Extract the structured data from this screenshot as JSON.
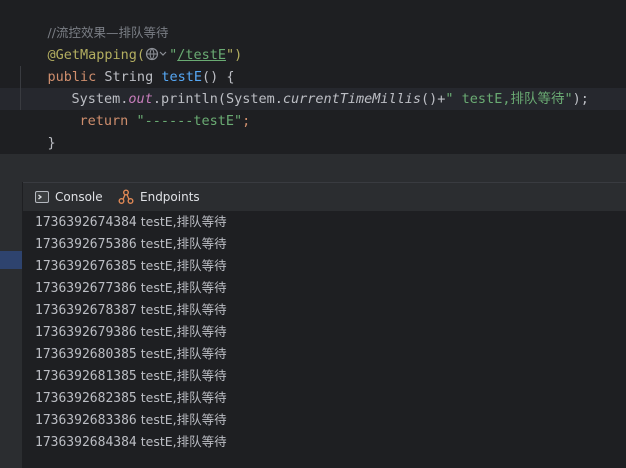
{
  "editor": {
    "comment": "//流控效果—排队等待",
    "annotation": "@GetMapping(",
    "mapping_url": "/testE",
    "annotation_close": "\")",
    "method_signature": {
      "kw_public": "public",
      "type": " String ",
      "name": "testE",
      "tail": "() {"
    },
    "println_line": {
      "p1": "System.",
      "field": "out",
      "p2": ".println(System.",
      "static_call": "currentTimeMillis",
      "p3": "()+",
      "str": "\" testE,排队等待\"",
      "p4": ");"
    },
    "return_line": {
      "kw": "return",
      "str": "\"------testE\"",
      "tail": ";"
    },
    "closing_brace": "}"
  },
  "tool_window": {
    "tabs": [
      {
        "label": "Console",
        "icon": "console-icon"
      },
      {
        "label": "Endpoints",
        "icon": "endpoints-icon"
      }
    ]
  },
  "console": {
    "lines": [
      {
        "ts": "1736392674384",
        "msg": " testE,排队等待"
      },
      {
        "ts": "1736392675386",
        "msg": " testE,排队等待"
      },
      {
        "ts": "1736392676385",
        "msg": " testE,排队等待"
      },
      {
        "ts": "1736392677386",
        "msg": " testE,排队等待"
      },
      {
        "ts": "1736392678387",
        "msg": " testE,排队等待"
      },
      {
        "ts": "1736392679386",
        "msg": " testE,排队等待"
      },
      {
        "ts": "1736392680385",
        "msg": " testE,排队等待"
      },
      {
        "ts": "1736392681385",
        "msg": " testE,排队等待"
      },
      {
        "ts": "1736392682385",
        "msg": " testE,排队等待"
      },
      {
        "ts": "1736392683386",
        "msg": " testE,排队等待"
      },
      {
        "ts": "1736392684384",
        "msg": " testE,排队等待"
      }
    ]
  },
  "colors": {
    "editor_bg": "#1e1f22",
    "panel_bg": "#2b2d30",
    "keyword": "#cf8e6d",
    "string": "#6aab73",
    "annotation": "#b3ae60",
    "function": "#56a8f5",
    "field": "#c77dbb"
  }
}
